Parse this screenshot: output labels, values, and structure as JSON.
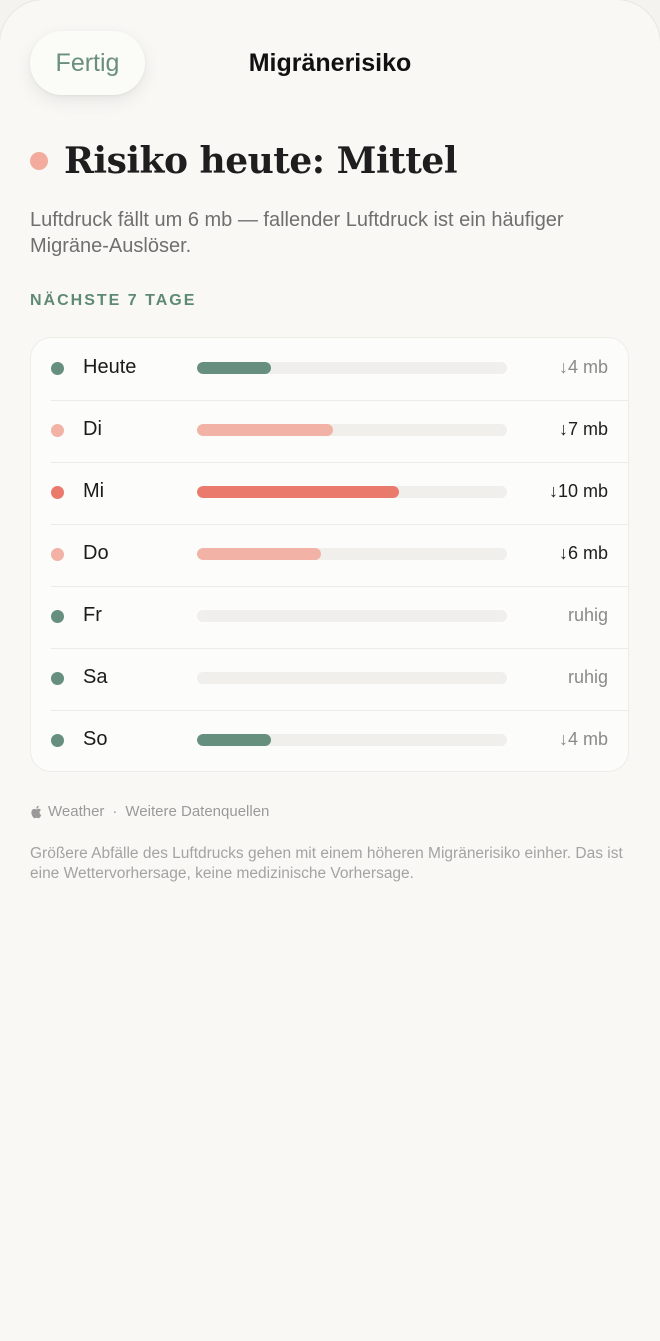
{
  "nav": {
    "done_label": "Fertig",
    "title": "Migränerisiko"
  },
  "risk": {
    "title": "Risiko heute: Mittel",
    "color": "#f2ab9c",
    "description": "Luftdruck fällt um 6 mb — fallender Luftdruck ist ein häufiger Migräne-Auslöser."
  },
  "forecast": {
    "section_label": "NÄCHSTE 7 TAGE",
    "days": [
      {
        "name": "Heute",
        "value": "↓4 mb",
        "level": "low",
        "fill": 0.24,
        "emphasis": false
      },
      {
        "name": "Di",
        "value": "↓7 mb",
        "level": "medium",
        "fill": 0.44,
        "emphasis": true
      },
      {
        "name": "Mi",
        "value": "↓10 mb",
        "level": "high",
        "fill": 0.65,
        "emphasis": true
      },
      {
        "name": "Do",
        "value": "↓6 mb",
        "level": "medium",
        "fill": 0.4,
        "emphasis": true
      },
      {
        "name": "Fr",
        "value": "ruhig",
        "level": "low",
        "fill": 0,
        "emphasis": false
      },
      {
        "name": "Sa",
        "value": "ruhig",
        "level": "low",
        "fill": 0,
        "emphasis": false
      },
      {
        "name": "So",
        "value": "↓4 mb",
        "level": "low",
        "fill": 0.24,
        "emphasis": false
      }
    ],
    "level_colors": {
      "low": "#668f7e",
      "medium": "#f2b3a6",
      "high": "#ea7a6b"
    }
  },
  "footer": {
    "source_name": "Weather",
    "separator": "·",
    "more_sources": "Weitere Datenquellen",
    "disclaimer": "Größere Abfälle des Luftdrucks gehen mit einem höheren Migränerisiko einher. Das ist eine Wettervorhersage, keine medizinische Vorhersage."
  }
}
